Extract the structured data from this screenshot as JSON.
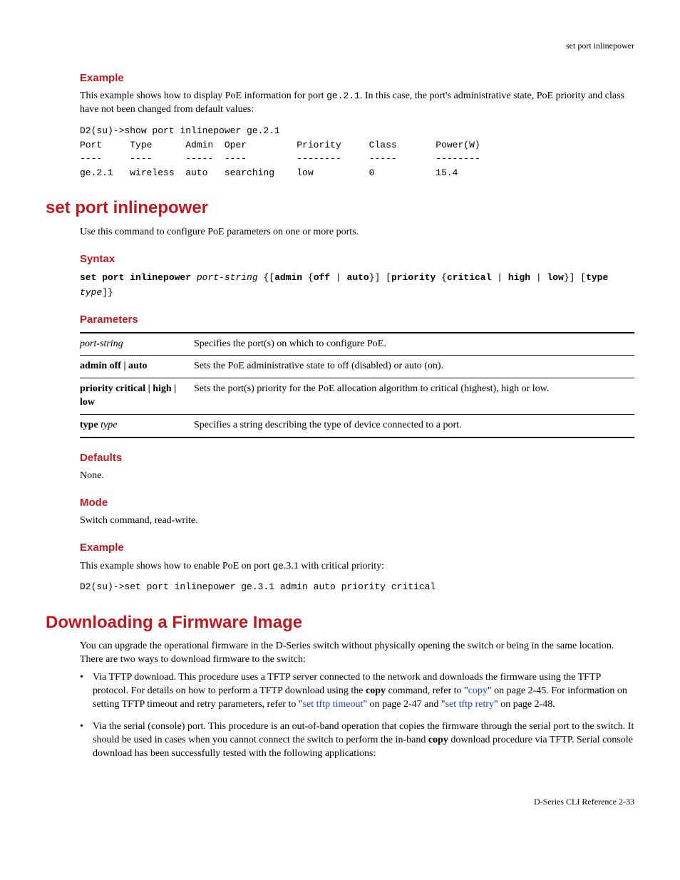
{
  "running_head": "set port inlinepower",
  "example1": {
    "heading": "Example",
    "intro_a": "This example shows how to display PoE information for port ",
    "intro_code": "ge.2.1",
    "intro_b": ". In this case, the port's administrative state, PoE priority and class have not been changed from default values:",
    "code": "D2(su)->show port inlinepower ge.2.1\nPort     Type      Admin  Oper         Priority     Class       Power(W)\n----     ----      -----  ----         --------     -----       --------\nge.2.1   wireless  auto   searching    low          0           15.4"
  },
  "cmd": {
    "title": "set port inlinepower",
    "desc": "Use this command to configure PoE parameters on one or more ports."
  },
  "syntax": {
    "heading": "Syntax",
    "kw_cmd": "set port inlinepower",
    "arg_port": "port-string",
    "kw_admin": "admin",
    "kw_off": "off",
    "kw_auto": "auto",
    "kw_priority": "priority",
    "kw_critical": "critical",
    "kw_high": "high",
    "kw_low": "low",
    "kw_type": "type",
    "arg_type": "type"
  },
  "params": {
    "heading": "Parameters",
    "rows": [
      {
        "name_html": "port-string",
        "desc": "Specifies the port(s) on which to configure PoE."
      },
      {
        "name_html": "admin off | auto",
        "desc": "Sets the PoE administrative state to off (disabled) or auto (on)."
      },
      {
        "name_html": "priority critical | high | low",
        "desc": "Sets the port(s) priority for the PoE allocation algorithm to critical (highest), high or low."
      },
      {
        "name_html": "type type",
        "desc": "Specifies a string describing the type of device connected to a port."
      }
    ]
  },
  "defaults": {
    "heading": "Defaults",
    "body": "None."
  },
  "mode": {
    "heading": "Mode",
    "body": "Switch command, read-write."
  },
  "example2": {
    "heading": "Example",
    "intro_a": "This example shows how to enable PoE on port ",
    "intro_code": "ge",
    "intro_b": ".3.1 with critical priority:",
    "code": "D2(su)->set port inlinepower ge.3.1 admin auto priority critical"
  },
  "firmware": {
    "title": "Downloading a Firmware Image",
    "intro": "You can upgrade the operational firmware in the D-Series switch without physically opening the switch or being in the same location. There are two ways to download firmware to the switch:",
    "b1_a": "Via TFTP download. This procedure uses a TFTP server connected to the network and downloads the firmware using the TFTP protocol. For details on how to perform a TFTP download using the ",
    "b1_copy_bold": "copy",
    "b1_b": " command, refer to \"",
    "b1_link1": "copy",
    "b1_c": "\" on page 2-45. For information on setting TFTP timeout and retry parameters, refer to \"",
    "b1_link2": "set tftp timeout",
    "b1_d": "\" on page 2-47 and \"",
    "b1_link3": "set tftp retry",
    "b1_e": "\" on page 2-48.",
    "b2_a": "Via the serial (console) port. This procedure is an out-of-band operation that copies the firmware through the serial port to the switch. It should be used in cases when you cannot connect the switch to perform the in-band ",
    "b2_copy_bold": "copy",
    "b2_b": " download procedure via TFTP. Serial console download has been successfully tested with the following applications:"
  },
  "footer": "D-Series CLI Reference   2-33"
}
